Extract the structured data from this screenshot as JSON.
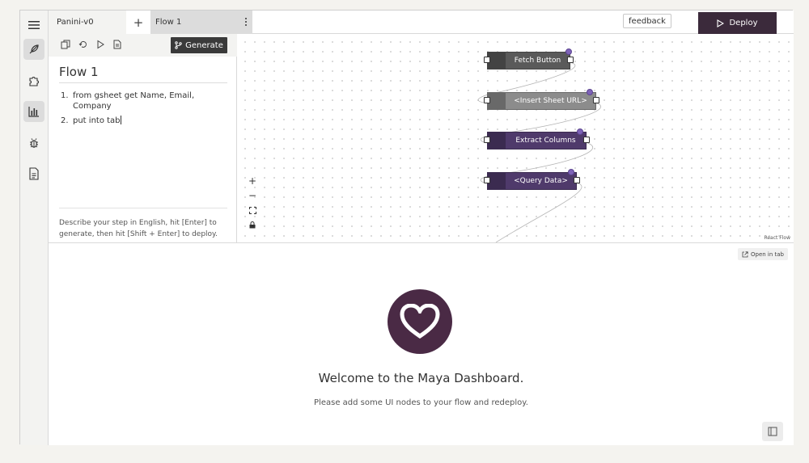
{
  "tabs": [
    {
      "label": "Panini-v0"
    },
    {
      "label": "Flow 1"
    }
  ],
  "header": {
    "feedback_label": "feedback",
    "deploy_label": "Deploy"
  },
  "rail": {
    "icons": [
      "menu-icon",
      "feather-icon",
      "puzzle-icon",
      "chart-icon",
      "bug-icon",
      "document-icon"
    ],
    "active": "chart-icon"
  },
  "editor": {
    "toolbar_icons": [
      "copy-icon",
      "refresh-icon",
      "play-icon",
      "file-icon"
    ],
    "generate_label": "Generate",
    "title": "Flow 1",
    "steps": [
      {
        "num": "1.",
        "text": "from gsheet get Name, Email, Company"
      },
      {
        "num": "2.",
        "text": "put into tab"
      }
    ],
    "hint": "Describe your step in English, hit [Enter] to generate, then hit [Shift + Enter] to deploy."
  },
  "canvas": {
    "nodes": [
      {
        "label": "Fetch Button",
        "color": "#5a5a5a",
        "status": true
      },
      {
        "label": "<Insert Sheet URL>",
        "color": "#8c8c8c",
        "status": true
      },
      {
        "label": "Extract Columns",
        "color": "#4f3a6b",
        "status": true
      },
      {
        "label": "<Query Data>",
        "color": "#4f3a6b",
        "status": true
      }
    ],
    "zoom_controls": [
      {
        "name": "zoom-in-button",
        "glyph": "+"
      },
      {
        "name": "zoom-out-button",
        "glyph": "−"
      },
      {
        "name": "fit-view-button",
        "glyph": "⛶"
      },
      {
        "name": "lock-button",
        "glyph": "🔒"
      }
    ],
    "attribution": "React Flow"
  },
  "dashboard": {
    "open_tab_label": "Open in tab",
    "welcome": "Welcome to the Maya Dashboard.",
    "subtitle": "Please add some UI nodes to your flow and redeploy."
  },
  "colors": {
    "brand": "#4a2a45",
    "deploy_bg": "#3b2a3b",
    "node_dark": "#4f3a6b",
    "status_dot": "#7e63b8"
  }
}
